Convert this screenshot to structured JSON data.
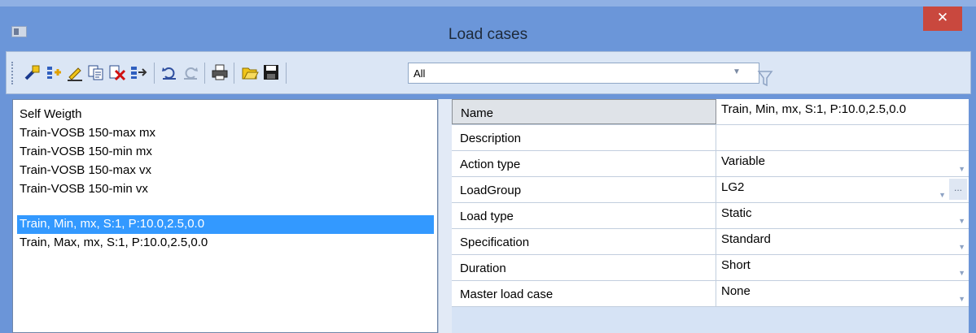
{
  "window": {
    "title": "Load cases",
    "close_label": "✕"
  },
  "toolbar": {
    "filter_value": "All",
    "filter_arrow": "▼",
    "icons": [
      "new-icon",
      "insert-icon",
      "edit-icon",
      "copy-icon",
      "delete-icon",
      "move-icon",
      "undo-icon",
      "redo-icon",
      "print-icon",
      "open-icon",
      "save-icon",
      "filter-icon"
    ]
  },
  "load_cases": [
    {
      "label": "Self Weigth",
      "selected": false
    },
    {
      "label": "Train-VOSB 150-max mx",
      "selected": false
    },
    {
      "label": "Train-VOSB 150-min mx",
      "selected": false
    },
    {
      "label": "Train-VOSB 150-max vx",
      "selected": false
    },
    {
      "label": "Train-VOSB 150-min vx",
      "selected": false
    },
    {
      "label": "Train, Min, mx, S:1, P:10.0,2.5,0.0",
      "selected": true
    },
    {
      "label": "Train, Max, mx, S:1, P:10.0,2.5,0.0",
      "selected": false
    }
  ],
  "properties": [
    {
      "name": "Name",
      "value": "Train, Min, mx, S:1, P:10.0,2.5,0.0",
      "dropdown": false
    },
    {
      "name": "Description",
      "value": "",
      "dropdown": false
    },
    {
      "name": "Action type",
      "value": "Variable",
      "dropdown": true
    },
    {
      "name": "LoadGroup",
      "value": "LG2",
      "dropdown": true,
      "ellipsis": "..."
    },
    {
      "name": "Load type",
      "value": "Static",
      "dropdown": true
    },
    {
      "name": "Specification",
      "value": "Standard",
      "dropdown": true
    },
    {
      "name": "Duration",
      "value": "Short",
      "dropdown": true
    },
    {
      "name": "Master load case",
      "value": "None",
      "dropdown": true
    }
  ],
  "colors": {
    "title_bar": "#6b96d9",
    "close_button": "#c9483e",
    "selection": "#3399ff",
    "property_panel": "#d6e3f5"
  }
}
